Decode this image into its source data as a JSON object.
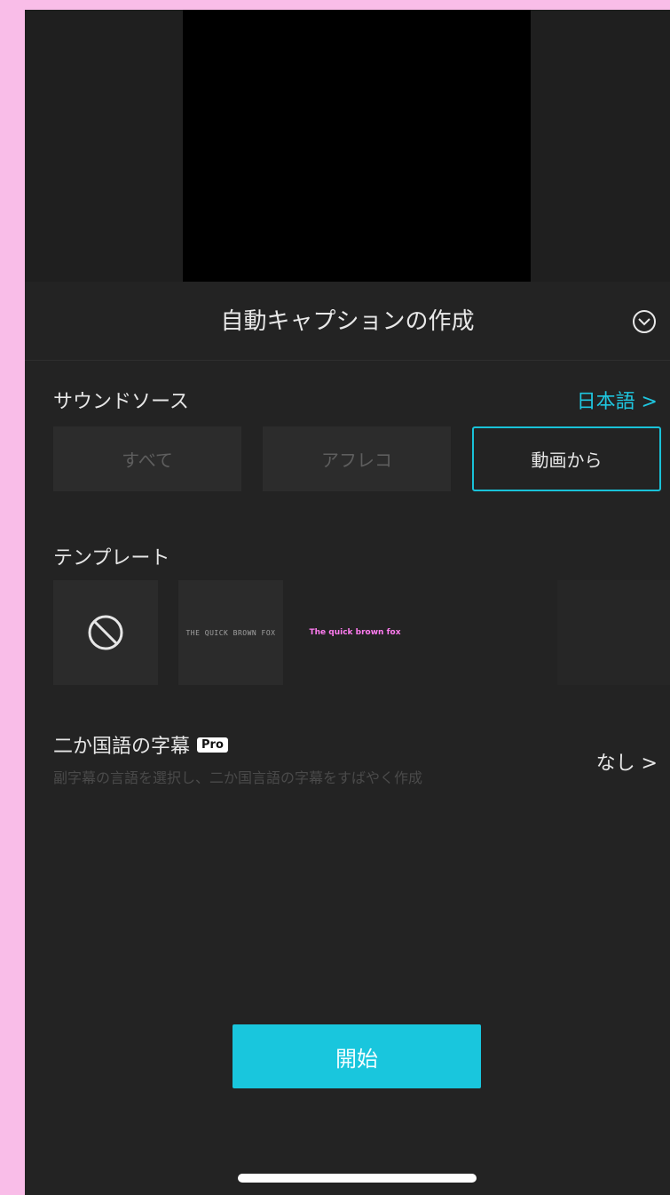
{
  "sheet": {
    "title": "自動キャプションの作成"
  },
  "sound_source": {
    "label": "サウンドソース",
    "language_link": "日本語 >",
    "options": [
      {
        "label": "すべて",
        "selected": false
      },
      {
        "label": "アフレコ",
        "selected": false
      },
      {
        "label": "動画から",
        "selected": true
      }
    ]
  },
  "templates": {
    "label": "テンプレート",
    "items": [
      {
        "type": "none",
        "icon": "prohibited-icon"
      },
      {
        "type": "sample",
        "text": "THE QUICK BROWN FOX"
      },
      {
        "type": "sample",
        "text": "The quick brown fox"
      },
      {
        "type": "sample",
        "text": ""
      }
    ]
  },
  "bilingual": {
    "title": "二か国語の字幕",
    "badge": "Pro",
    "subtitle": "副字幕の言語を選択し、二か国言語の字幕をすばやく作成",
    "value": "なし >"
  },
  "start_button": {
    "label": "開始"
  },
  "colors": {
    "accent": "#19c6dd",
    "background": "#232323",
    "outer": "#f9bde8"
  }
}
